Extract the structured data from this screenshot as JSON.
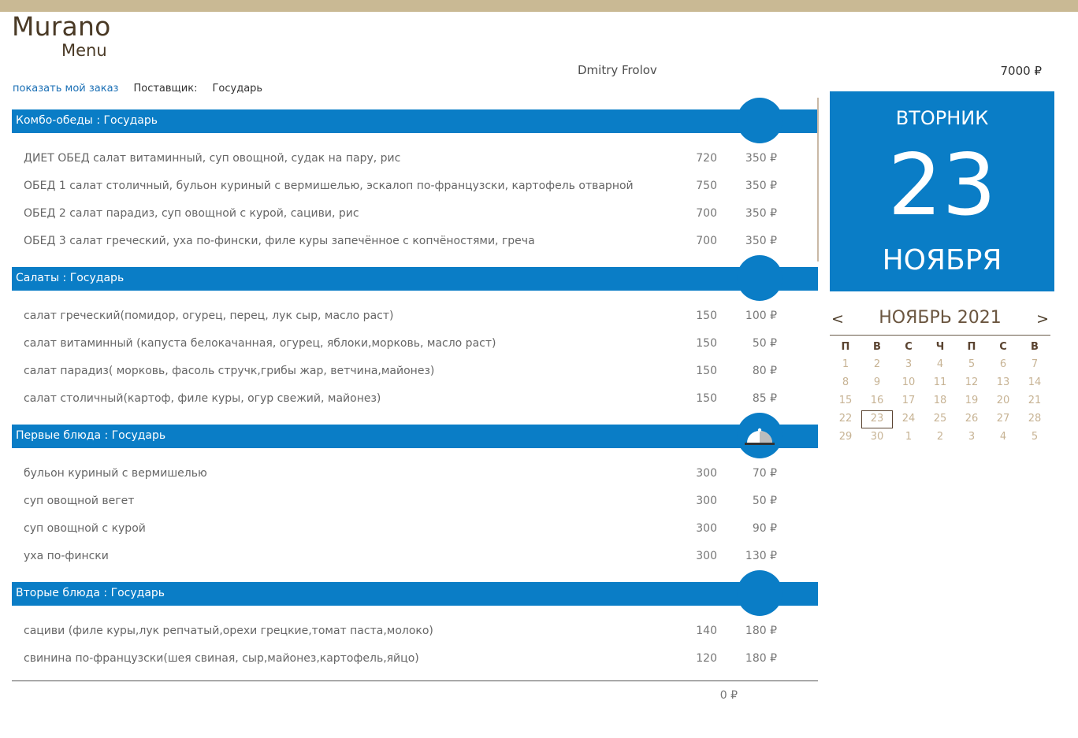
{
  "header": {
    "logo_title": "Murano",
    "logo_subtitle": "Menu",
    "user_name": "Dmitry Frolov",
    "balance": "7000 ₽"
  },
  "toolbar": {
    "show_order_link": "показать мой заказ",
    "supplier_label": "Поставщик:",
    "supplier_value": "Государь"
  },
  "sections": [
    {
      "title": "Комбо-обеды : Государь",
      "icon": "circle",
      "items": [
        {
          "name": "ДИЕТ ОБЕД салат витаминный, суп овощной, судак на пару, рис",
          "weight": "720",
          "price": "350 ₽"
        },
        {
          "name": "ОБЕД 1 салат столичный, бульон куриный с вермишелью, эскалоп по-французски, картофель отварной",
          "weight": "750",
          "price": "350 ₽"
        },
        {
          "name": "ОБЕД 2 салат парадиз, суп овощной с курой, сациви, рис",
          "weight": "700",
          "price": "350 ₽"
        },
        {
          "name": "ОБЕД 3 салат греческий, уха по-фински, филе куры запечённое с копчёностями, греча",
          "weight": "700",
          "price": "350 ₽"
        }
      ]
    },
    {
      "title": "Салаты : Государь",
      "icon": "circle",
      "items": [
        {
          "name": "салат греческий(помидор, огурец, перец, лук сыр, масло раст)",
          "weight": "150",
          "price": "100 ₽"
        },
        {
          "name": "салат витаминный (капуста белокачанная, огурец, яблоки,морковь, масло раст)",
          "weight": "150",
          "price": "50 ₽"
        },
        {
          "name": "салат парадиз( морковь, фасоль стручк,грибы жар, ветчина,майонез)",
          "weight": "150",
          "price": "80 ₽"
        },
        {
          "name": "салат столичный(картоф, филе куры, огур свежий, майонез)",
          "weight": "150",
          "price": "85 ₽"
        }
      ]
    },
    {
      "title": "Первые блюда : Государь",
      "icon": "cloche-icon",
      "items": [
        {
          "name": "бульон куриный с вермишелью",
          "weight": "300",
          "price": "70 ₽"
        },
        {
          "name": "суп овощной вегет",
          "weight": "300",
          "price": "50 ₽"
        },
        {
          "name": "суп овощной с курой",
          "weight": "300",
          "price": "90 ₽"
        },
        {
          "name": "уха по-фински",
          "weight": "300",
          "price": "130 ₽"
        }
      ]
    },
    {
      "title": "Вторые блюда : Государь",
      "icon": "circle",
      "items": [
        {
          "name": "сациви (филе куры,лук репчатый,орехи грецкие,томат паста,молоко)",
          "weight": "140",
          "price": "180 ₽"
        },
        {
          "name": "свинина по-французски(шея свиная, сыр,майонез,картофель,яйцо)",
          "weight": "120",
          "price": "180 ₽"
        }
      ]
    }
  ],
  "order_total": "0 ₽",
  "date_card": {
    "weekday": "ВТОРНИК",
    "day": "23",
    "month": "НОЯБРЯ"
  },
  "calendar": {
    "prev": "<",
    "next": ">",
    "title": "НОЯБРЬ 2021",
    "weekdays": [
      "П",
      "В",
      "С",
      "Ч",
      "П",
      "С",
      "В"
    ],
    "days": [
      {
        "d": "1"
      },
      {
        "d": "2"
      },
      {
        "d": "3"
      },
      {
        "d": "4"
      },
      {
        "d": "5"
      },
      {
        "d": "6"
      },
      {
        "d": "7"
      },
      {
        "d": "8"
      },
      {
        "d": "9"
      },
      {
        "d": "10"
      },
      {
        "d": "11"
      },
      {
        "d": "12"
      },
      {
        "d": "13"
      },
      {
        "d": "14"
      },
      {
        "d": "15"
      },
      {
        "d": "16"
      },
      {
        "d": "17"
      },
      {
        "d": "18"
      },
      {
        "d": "19"
      },
      {
        "d": "20"
      },
      {
        "d": "21"
      },
      {
        "d": "22"
      },
      {
        "d": "23",
        "today": true
      },
      {
        "d": "24"
      },
      {
        "d": "25"
      },
      {
        "d": "26"
      },
      {
        "d": "27"
      },
      {
        "d": "28"
      },
      {
        "d": "29"
      },
      {
        "d": "30"
      },
      {
        "d": "1",
        "other": true
      },
      {
        "d": "2",
        "other": true
      },
      {
        "d": "3",
        "other": true
      },
      {
        "d": "4",
        "other": true
      },
      {
        "d": "5",
        "other": true
      }
    ]
  },
  "colors": {
    "accent": "#0a7dc6",
    "topbar": "#c9b994",
    "brand_text": "#4a3a26"
  }
}
